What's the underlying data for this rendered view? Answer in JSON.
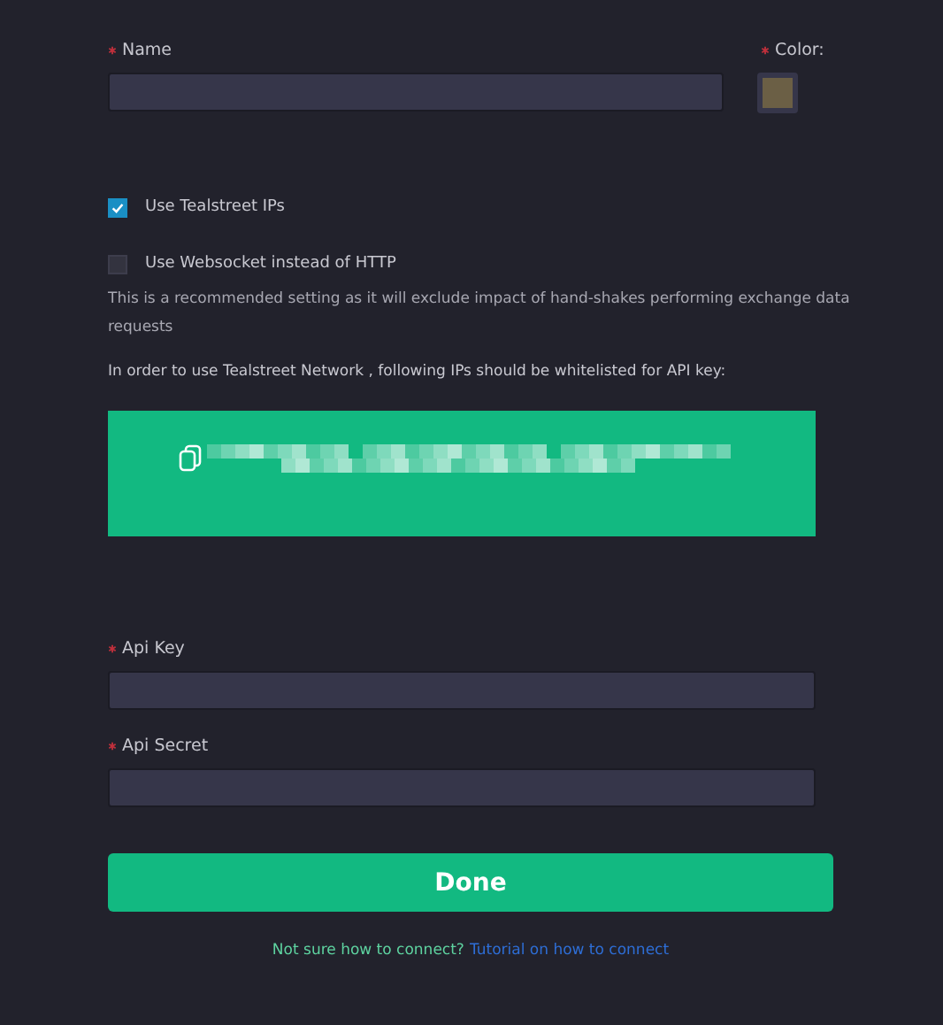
{
  "name_field": {
    "label": "Name",
    "required": true
  },
  "color_field": {
    "label": "Color:",
    "required": true,
    "color": "#6b5f45"
  },
  "options": [
    {
      "label": "Use Tealstreet IPs",
      "checked": true
    },
    {
      "label": "Use Websocket instead of HTTP",
      "checked": false
    }
  ],
  "hint": "This is a recommended setting as it will exclude impact of hand-shakes performing exchange data requests",
  "ip_notice": "In order to use Tealstreet Network , following IPs should be whitelisted for API key:",
  "fields": [
    {
      "label": "Api Key",
      "required": true
    },
    {
      "label": "Api Secret",
      "required": true
    }
  ],
  "done_button": "Done",
  "footer": {
    "question": "Not sure how to connect?",
    "link": "Tutorial on how to connect"
  }
}
